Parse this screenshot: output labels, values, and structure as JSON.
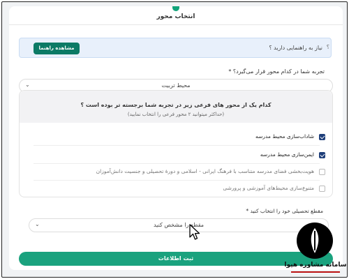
{
  "header": {
    "title": "انتخاب محور"
  },
  "guide": {
    "question": "نیاز به راهنمایی دارید ؟",
    "button_label": "مشاهده راهنما"
  },
  "main_question": {
    "label": "تجربه شما در کدام محور قرار می‌گیرد؟ *",
    "selected": "محیط تربیت"
  },
  "panel": {
    "question": "کدام یک از محور های فرعی زیر در تجربه شما برجسته تر بوده است ؟",
    "note": "(حداکثر میتوانید ۲ محور فرعی را انتخاب نمایید)",
    "options": [
      {
        "label": "شاداب‌سازی محیط مدرسه",
        "checked": true
      },
      {
        "label": "ایمن‌سازی محیط مدرسه",
        "checked": true
      },
      {
        "label": "هویت‌بخشی فضای مدرسه متناسب با فرهنگ ایرانی - اسلامی و دورهٔ تحصیلی و جنسیت دانش‌آموزان",
        "checked": false
      },
      {
        "label": "متنوع‌سازی محیط‌های آموزشی و پرورشی",
        "checked": false
      }
    ]
  },
  "grade": {
    "label": "مقطع تحصیلی خود را انتخاب کنید *",
    "placeholder": "مقطع را مشخص کنید"
  },
  "submit": {
    "label": "ثبت اطلاعات"
  },
  "watermark": {
    "text": "سامانه مشاوره هپوا"
  },
  "colors": {
    "primary": "#1aa27e",
    "guide_button": "#0b7a65",
    "checkbox": "#1f3f7a"
  }
}
